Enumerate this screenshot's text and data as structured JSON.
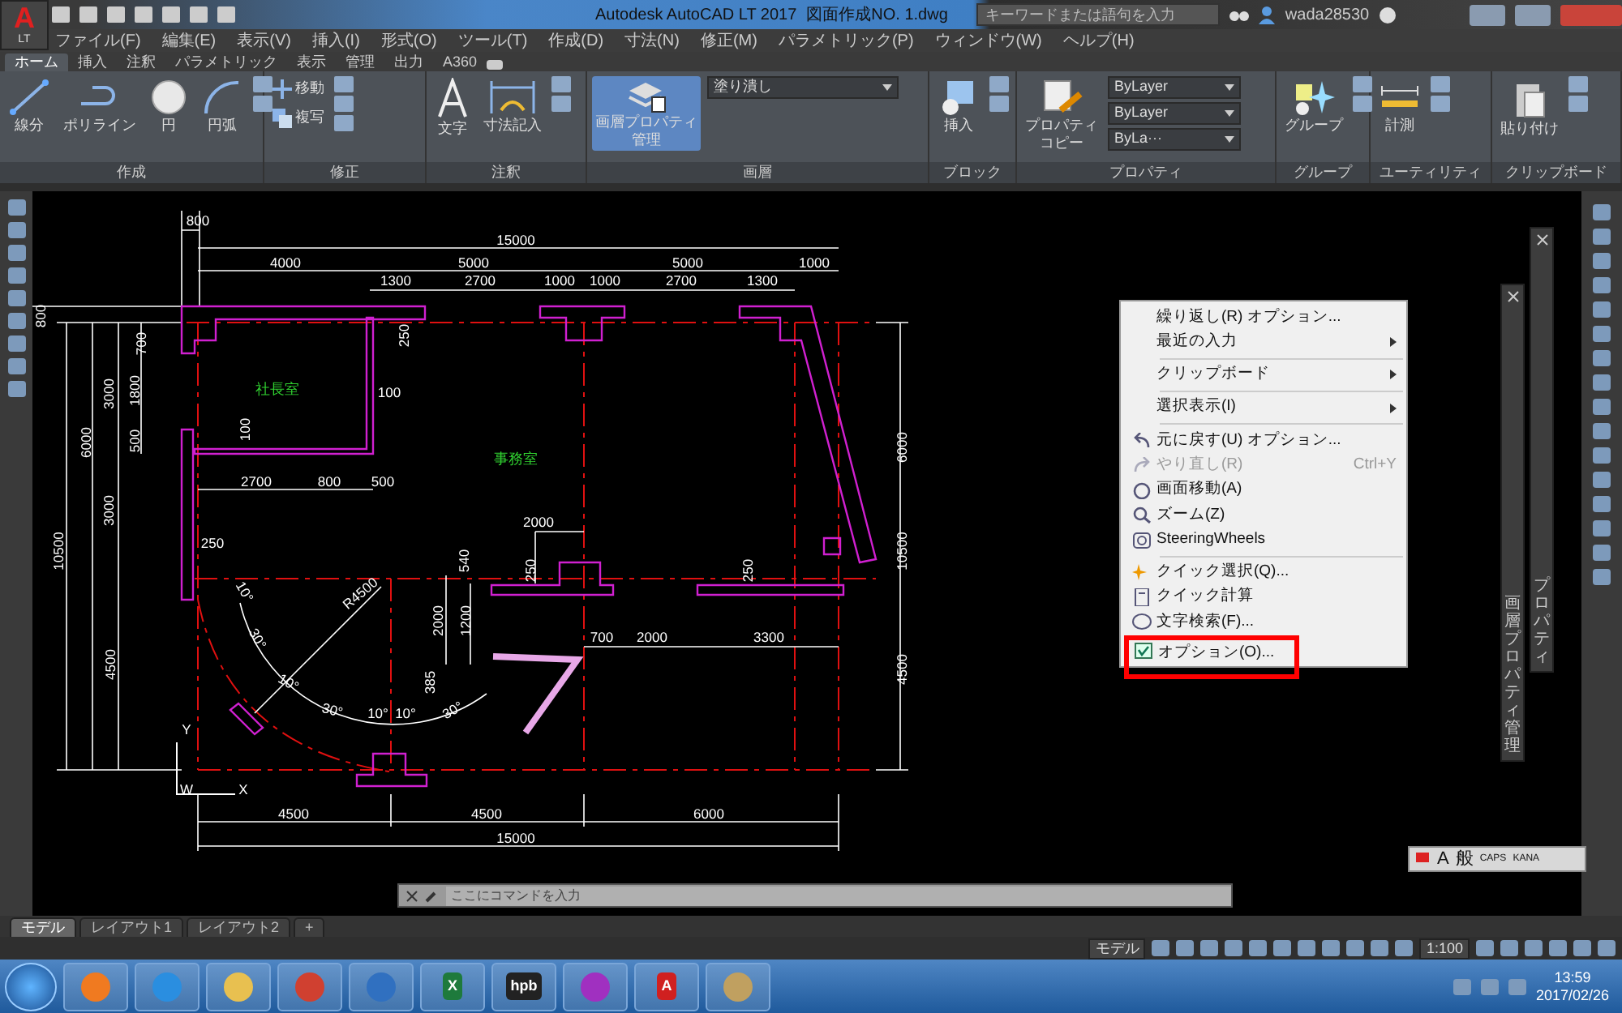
{
  "app_button": {
    "letter": "A",
    "edition": "LT"
  },
  "title_bar": {
    "app_title": "Autodesk AutoCAD LT 2017",
    "document": "図面作成NO. 1.dwg",
    "search": {
      "placeholder": "キーワードまたは語句を入力"
    },
    "user": "wada28530"
  },
  "menu_bar": [
    "ファイル(F)",
    "編集(E)",
    "表示(V)",
    "挿入(I)",
    "形式(O)",
    "ツール(T)",
    "作成(D)",
    "寸法(N)",
    "修正(M)",
    "パラメトリック(P)",
    "ウィンドウ(W)",
    "ヘルプ(H)"
  ],
  "ribbon": {
    "tabs": [
      {
        "label": "ホーム",
        "selected": true
      },
      {
        "label": "挿入",
        "selected": false
      },
      {
        "label": "注釈",
        "selected": false
      },
      {
        "label": "パラメトリック",
        "selected": false
      },
      {
        "label": "表示",
        "selected": false
      },
      {
        "label": "管理",
        "selected": false
      },
      {
        "label": "出力",
        "selected": false
      },
      {
        "label": "A360",
        "selected": false
      }
    ],
    "panels": [
      {
        "title": "作成",
        "tools": [
          {
            "kind": "large",
            "label": "線分"
          },
          {
            "kind": "large",
            "label": "ポリライン"
          },
          {
            "kind": "large",
            "label": "円"
          },
          {
            "kind": "large",
            "label": "円弧"
          }
        ]
      },
      {
        "title": "修正",
        "tools": [
          {
            "kind": "small",
            "label": "移動"
          },
          {
            "kind": "small",
            "label": "複写"
          }
        ]
      },
      {
        "title": "注釈",
        "tools": [
          {
            "kind": "large",
            "label": "文字"
          },
          {
            "kind": "large",
            "label": "寸法記入"
          }
        ]
      },
      {
        "title": "画層",
        "tools": [
          {
            "kind": "large",
            "label_lines": [
              "画層プロパティ",
              "管理"
            ],
            "selected": true
          },
          {
            "kind": "dropdown",
            "label": "塗り潰し"
          }
        ]
      },
      {
        "title": "ブロック",
        "tools": [
          {
            "kind": "large",
            "label": "挿入"
          }
        ]
      },
      {
        "title": "プロパティ",
        "tools": [
          {
            "kind": "large",
            "label_lines": [
              "プロパティ",
              "コピー"
            ],
            "selected": false
          },
          {
            "kind": "dropdown",
            "label": "ByLayer"
          },
          {
            "kind": "dropdown",
            "label": "ByLayer"
          },
          {
            "kind": "dropdown",
            "label": "ByLa···"
          }
        ]
      },
      {
        "title": "グループ",
        "tools": [
          {
            "kind": "large",
            "label": "グループ"
          }
        ]
      },
      {
        "title": "ユーティリティ",
        "tools": [
          {
            "kind": "large",
            "label": "計測"
          }
        ]
      },
      {
        "title": "クリップボード",
        "tools": [
          {
            "kind": "large",
            "label": "貼り付け"
          }
        ]
      }
    ]
  },
  "drawing": {
    "labels": [
      {
        "text": "800",
        "kind": "dim"
      },
      {
        "text": "15000",
        "kind": "dim"
      },
      {
        "text": "4000",
        "kind": "dim"
      },
      {
        "text": "5000",
        "kind": "dim"
      },
      {
        "text": "5000",
        "kind": "dim"
      },
      {
        "text": "1000",
        "kind": "dim"
      },
      {
        "text": "1300",
        "kind": "dim"
      },
      {
        "text": "2700",
        "kind": "dim"
      },
      {
        "text": "1000",
        "kind": "dim"
      },
      {
        "text": "1000",
        "kind": "dim"
      },
      {
        "text": "2700",
        "kind": "dim"
      },
      {
        "text": "1300",
        "kind": "dim"
      },
      {
        "text": "800",
        "kind": "dim"
      },
      {
        "text": "700",
        "kind": "dim"
      },
      {
        "text": "250",
        "kind": "dim"
      },
      {
        "text": "3000",
        "kind": "dim"
      },
      {
        "text": "1800",
        "kind": "dim"
      },
      {
        "text": "社長室",
        "kind": "room"
      },
      {
        "text": "100",
        "kind": "dim"
      },
      {
        "text": "6000",
        "kind": "dim"
      },
      {
        "text": "500",
        "kind": "dim"
      },
      {
        "text": "100",
        "kind": "dim"
      },
      {
        "text": "6000",
        "kind": "dim"
      },
      {
        "text": "事務室",
        "kind": "room"
      },
      {
        "text": "2700",
        "kind": "dim"
      },
      {
        "text": "800",
        "kind": "dim"
      },
      {
        "text": "500",
        "kind": "dim"
      },
      {
        "text": "3000",
        "kind": "dim"
      },
      {
        "text": "2000",
        "kind": "dim"
      },
      {
        "text": "250",
        "kind": "dim"
      },
      {
        "text": "10500",
        "kind": "dim"
      },
      {
        "text": "10500",
        "kind": "dim"
      },
      {
        "text": "540",
        "kind": "dim"
      },
      {
        "text": "250",
        "kind": "dim"
      },
      {
        "text": "250",
        "kind": "dim"
      },
      {
        "text": "10°",
        "kind": "dim"
      },
      {
        "text": "R4500",
        "kind": "dim"
      },
      {
        "text": "2000",
        "kind": "dim"
      },
      {
        "text": "1200",
        "kind": "dim"
      },
      {
        "text": "30°",
        "kind": "dim"
      },
      {
        "text": "700",
        "kind": "dim"
      },
      {
        "text": "2000",
        "kind": "dim"
      },
      {
        "text": "3300",
        "kind": "dim"
      },
      {
        "text": "4500",
        "kind": "dim"
      },
      {
        "text": "4500",
        "kind": "dim"
      },
      {
        "text": "10°",
        "kind": "dim"
      },
      {
        "text": "385",
        "kind": "dim"
      },
      {
        "text": "30°",
        "kind": "dim"
      },
      {
        "text": "30°",
        "kind": "dim"
      },
      {
        "text": "Y",
        "kind": "axis"
      },
      {
        "text": "10°",
        "kind": "dim"
      },
      {
        "text": "10°",
        "kind": "dim"
      },
      {
        "text": "W",
        "kind": "axis"
      },
      {
        "text": "X",
        "kind": "axis"
      },
      {
        "text": "4500",
        "kind": "dim"
      },
      {
        "text": "4500",
        "kind": "dim"
      },
      {
        "text": "6000",
        "kind": "dim"
      },
      {
        "text": "15000",
        "kind": "dim"
      }
    ]
  },
  "context_menu": {
    "items": [
      {
        "kind": "item",
        "label": "繰り返し(R) オプション...",
        "submenu": false,
        "disabled": false
      },
      {
        "kind": "item",
        "label": "最近の入力",
        "submenu": true,
        "disabled": false
      },
      {
        "kind": "separator"
      },
      {
        "kind": "item",
        "label": "クリップボード",
        "submenu": true,
        "disabled": false
      },
      {
        "kind": "separator"
      },
      {
        "kind": "item",
        "label": "選択表示(I)",
        "submenu": true,
        "disabled": false
      },
      {
        "kind": "separator"
      },
      {
        "kind": "item",
        "label": "元に戻す(U) オプション...",
        "submenu": false,
        "disabled": false
      },
      {
        "kind": "item",
        "label": "やり直し(R)",
        "shortcut": "Ctrl+Y",
        "submenu": false,
        "disabled": true
      },
      {
        "kind": "item",
        "label": "画面移動(A)",
        "submenu": false,
        "disabled": false
      },
      {
        "kind": "item",
        "label": "ズーム(Z)",
        "submenu": false,
        "disabled": false
      },
      {
        "kind": "item",
        "label": "SteeringWheels",
        "submenu": false,
        "disabled": false
      },
      {
        "kind": "separator"
      },
      {
        "kind": "item",
        "label": "クイック選択(Q)...",
        "submenu": false,
        "disabled": false
      },
      {
        "kind": "item",
        "label": "クイック計算",
        "submenu": false,
        "disabled": false
      },
      {
        "kind": "item",
        "label": "文字検索(F)...",
        "submenu": false,
        "disabled": false
      },
      {
        "kind": "item",
        "label": "オプション(O)...",
        "submenu": false,
        "disabled": false,
        "annotated": true
      }
    ]
  },
  "palettes": [
    {
      "title": "画層プロパティ管理"
    },
    {
      "title": "プロパティ"
    }
  ],
  "command_line": {
    "placeholder": "ここにコマンドを入力"
  },
  "ime_bar": [
    "A",
    "般",
    "CAPS",
    "KANA"
  ],
  "layout_tabs": [
    {
      "label": "モデル",
      "selected": true
    },
    {
      "label": "レイアウト1",
      "selected": false
    },
    {
      "label": "レイアウト2",
      "selected": false
    }
  ],
  "add_layout_tab": "+",
  "status_bar": {
    "model": "モデル",
    "scale": "1:100"
  },
  "taskbar": {
    "apps": [
      {
        "kind": "media"
      },
      {
        "kind": "ie"
      },
      {
        "kind": "folder"
      },
      {
        "kind": "chrome"
      },
      {
        "kind": "mail"
      },
      {
        "kind": "excel",
        "text": "X"
      },
      {
        "kind": "hpb",
        "text": "hpb"
      },
      {
        "kind": "character"
      },
      {
        "kind": "autocad",
        "text": "A"
      },
      {
        "kind": "paint"
      }
    ],
    "clock": {
      "time": "13:59",
      "date": "2017/02/26"
    }
  }
}
